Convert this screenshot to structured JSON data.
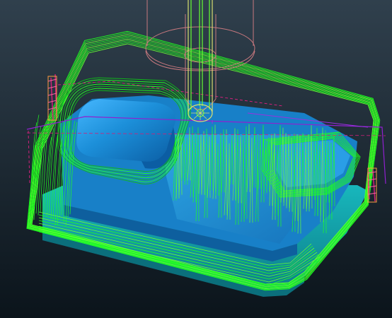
{
  "viewport": {
    "colors": {
      "background_top": "#30404d",
      "background_bottom": "#0b141b",
      "part_surface": "#1c8fd9",
      "part_highlight": "#47b8ff",
      "part_shadow": "#0b5da3",
      "base_plate": "#16a7b0",
      "base_plate_dark": "#0d7f8b",
      "toolpath": "#20ff20",
      "toolpath_bright": "#66ff33",
      "toolpath_dark": "#0fb81a",
      "tool_outline": "#c7787e",
      "tool_shank": "#d8e070",
      "stock_box": "#d0207a",
      "stock_box_edge": "#9020d0",
      "end_marker": "#ff9c40"
    },
    "icons": {
      "tool": "cutting-tool-icon",
      "stock": "stock-boundary-icon"
    }
  }
}
